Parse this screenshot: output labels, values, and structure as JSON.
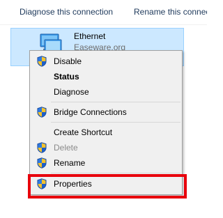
{
  "toolbar": {
    "diagnose_label": "Diagnose this connection",
    "rename_label": "Rename this connection"
  },
  "connection": {
    "name": "Ethernet",
    "sub": "Easeware.org",
    "icon": "network-adapter-icon"
  },
  "menu": {
    "items": [
      {
        "label": "Disable",
        "icon": "uac-shield-icon"
      },
      {
        "label": "Status"
      },
      {
        "label": "Diagnose"
      },
      {
        "label": "Bridge Connections",
        "icon": "uac-shield-icon"
      },
      {
        "label": "Create Shortcut"
      },
      {
        "label": "Delete",
        "icon": "uac-shield-icon",
        "disabled": true
      },
      {
        "label": "Rename",
        "icon": "uac-shield-icon"
      },
      {
        "label": "Properties",
        "icon": "uac-shield-icon",
        "highlighted": true
      }
    ]
  },
  "colors": {
    "selection_bg": "#cce8ff",
    "selection_border": "#99d1ff",
    "highlight": "#e8000c",
    "menu_bg": "#f0f0f0"
  }
}
